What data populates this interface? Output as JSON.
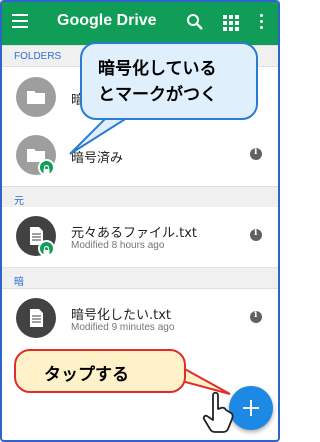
{
  "appbar": {
    "title": "Google Drive"
  },
  "sections": {
    "folders": "FOLDERS",
    "gen": "元",
    "an": "暗"
  },
  "rows": [
    {
      "name": "暗"
    },
    {
      "name": "暗号済み"
    },
    {
      "name": "元々あるファイル.txt",
      "sub": "Modified 8 hours ago"
    },
    {
      "name": "暗号化したい.txt",
      "sub": "Modified 9 minutes ago"
    }
  ],
  "callouts": {
    "encrypted_line1": "暗号化している",
    "encrypted_line2": "とマークがつく",
    "tap": "タップする"
  },
  "colors": {
    "appbar": "#0f9d58",
    "fab": "#1e88e5",
    "lock_badge": "#0f9d58"
  }
}
